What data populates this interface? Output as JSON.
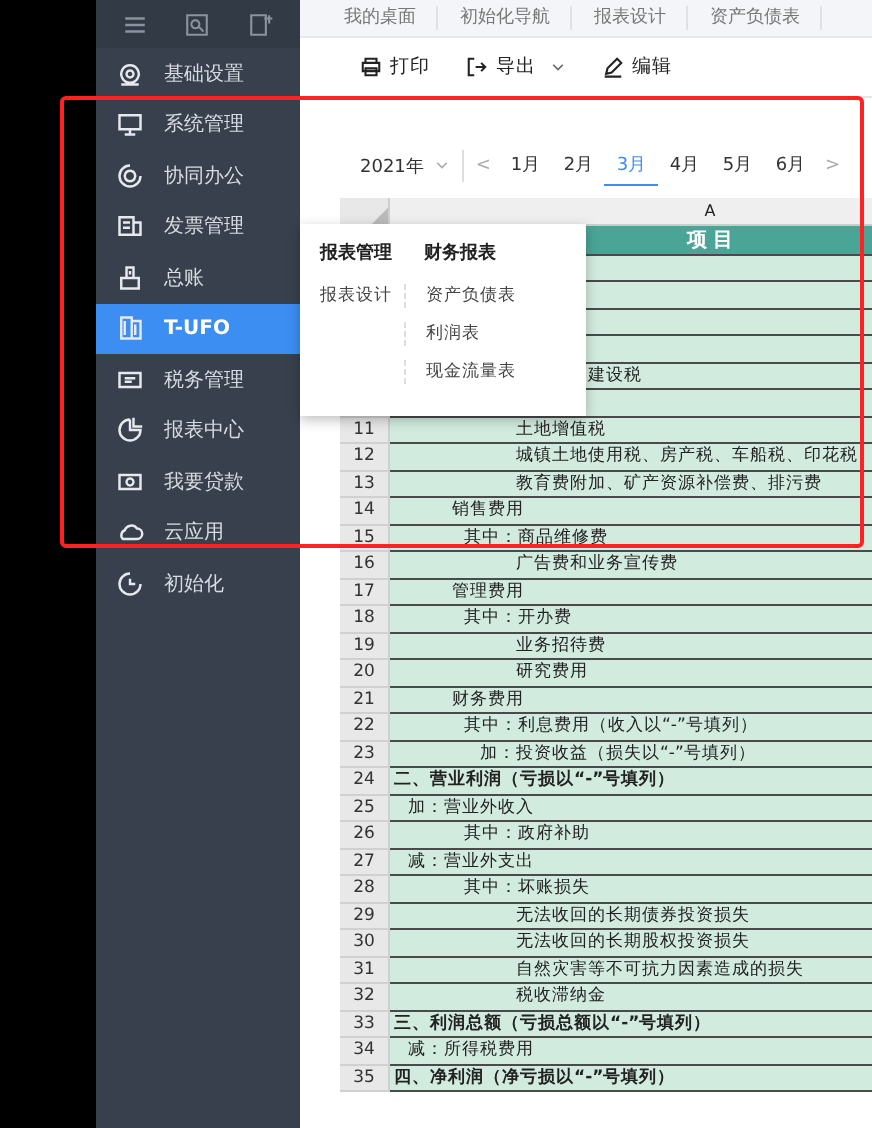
{
  "sidebar": {
    "items": [
      {
        "label": "基础设置",
        "selected": false
      },
      {
        "label": "系统管理",
        "selected": false
      },
      {
        "label": "协同办公",
        "selected": false
      },
      {
        "label": "发票管理",
        "selected": false
      },
      {
        "label": "总账",
        "selected": false
      },
      {
        "label": "T-UFO",
        "selected": true
      },
      {
        "label": "税务管理",
        "selected": false
      },
      {
        "label": "报表中心",
        "selected": false
      },
      {
        "label": "我要贷款",
        "selected": false
      },
      {
        "label": "云应用",
        "selected": false
      },
      {
        "label": "初始化",
        "selected": false
      }
    ]
  },
  "tabs": [
    {
      "label": "我的桌面",
      "selected": false
    },
    {
      "label": "初始化导航",
      "selected": false
    },
    {
      "label": "报表设计",
      "selected": false
    },
    {
      "label": "资产负债表",
      "selected": false
    }
  ],
  "toolbar": [
    {
      "kind": "print",
      "label": "打印"
    },
    {
      "kind": "export",
      "label": "导出"
    },
    {
      "kind": "edit",
      "label": "编辑"
    }
  ],
  "period": {
    "year": "2021年",
    "prev": "<",
    "next": ">",
    "months": [
      {
        "label": "1月",
        "selected": false
      },
      {
        "label": "2月",
        "selected": false
      },
      {
        "label": "3月",
        "selected": true
      },
      {
        "label": "4月",
        "selected": false
      },
      {
        "label": "5月",
        "selected": false
      },
      {
        "label": "6月",
        "selected": false
      }
    ]
  },
  "sheet": {
    "column": "A",
    "header": "项 目",
    "rows": [
      {
        "kind": "blank"
      },
      {
        "kind": "blank"
      },
      {
        "kind": "blank"
      },
      {
        "kind": "blank"
      },
      {
        "kind": "tail",
        "text": "建设税"
      },
      {
        "kind": "blank"
      },
      {
        "number": "11",
        "kind": "item",
        "text": "土地增值税"
      },
      {
        "number": "12",
        "kind": "item",
        "text": "城镇土地使用税、房产税、车船税、印花税"
      },
      {
        "number": "13",
        "kind": "item",
        "text": "教育费附加、矿产资源补偿费、排污费"
      },
      {
        "number": "14",
        "kind": "group",
        "text": "销售费用"
      },
      {
        "number": "15",
        "kind": "sub",
        "text": "其中：商品维修费"
      },
      {
        "number": "16",
        "kind": "item",
        "text": "广告费和业务宣传费"
      },
      {
        "number": "17",
        "kind": "group",
        "text": "管理费用"
      },
      {
        "number": "18",
        "kind": "sub",
        "text": "其中：开办费"
      },
      {
        "number": "19",
        "kind": "item",
        "text": "业务招待费"
      },
      {
        "number": "20",
        "kind": "item",
        "text": "研究费用"
      },
      {
        "number": "21",
        "kind": "group",
        "text": "财务费用"
      },
      {
        "number": "22",
        "kind": "sub",
        "text": "其中：利息费用（收入以“-”号填列）"
      },
      {
        "number": "23",
        "kind": "add",
        "text": "加：投资收益（损失以“-”号填列）"
      },
      {
        "number": "24",
        "kind": "total",
        "text": "二、营业利润（亏损以“-”号填列）"
      },
      {
        "number": "25",
        "kind": "adj",
        "text": "加：营业外收入"
      },
      {
        "number": "26",
        "kind": "sub",
        "text": "其中：政府补助"
      },
      {
        "number": "27",
        "kind": "adj",
        "text": "减：营业外支出"
      },
      {
        "number": "28",
        "kind": "sub",
        "text": "其中：坏账损失"
      },
      {
        "number": "29",
        "kind": "item",
        "text": "无法收回的长期债券投资损失"
      },
      {
        "number": "30",
        "kind": "item",
        "text": "无法收回的长期股权投资损失"
      },
      {
        "number": "31",
        "kind": "item",
        "text": "自然灾害等不可抗力因素造成的损失"
      },
      {
        "number": "32",
        "kind": "item",
        "text": "税收滞纳金"
      },
      {
        "number": "33",
        "kind": "total",
        "text": "三、利润总额（亏损总额以“-”号填列）"
      },
      {
        "number": "34",
        "kind": "adj",
        "text": "减：所得税费用"
      },
      {
        "number": "35",
        "kind": "total",
        "text": "四、净利润（净亏损以“-”号填列）"
      }
    ]
  },
  "flyout": {
    "columns": [
      {
        "title": "报表管理",
        "items": [
          "报表设计"
        ]
      },
      {
        "title": "财务报表",
        "items": [
          "资产负债表",
          "利润表",
          "现金流量表"
        ]
      }
    ]
  }
}
